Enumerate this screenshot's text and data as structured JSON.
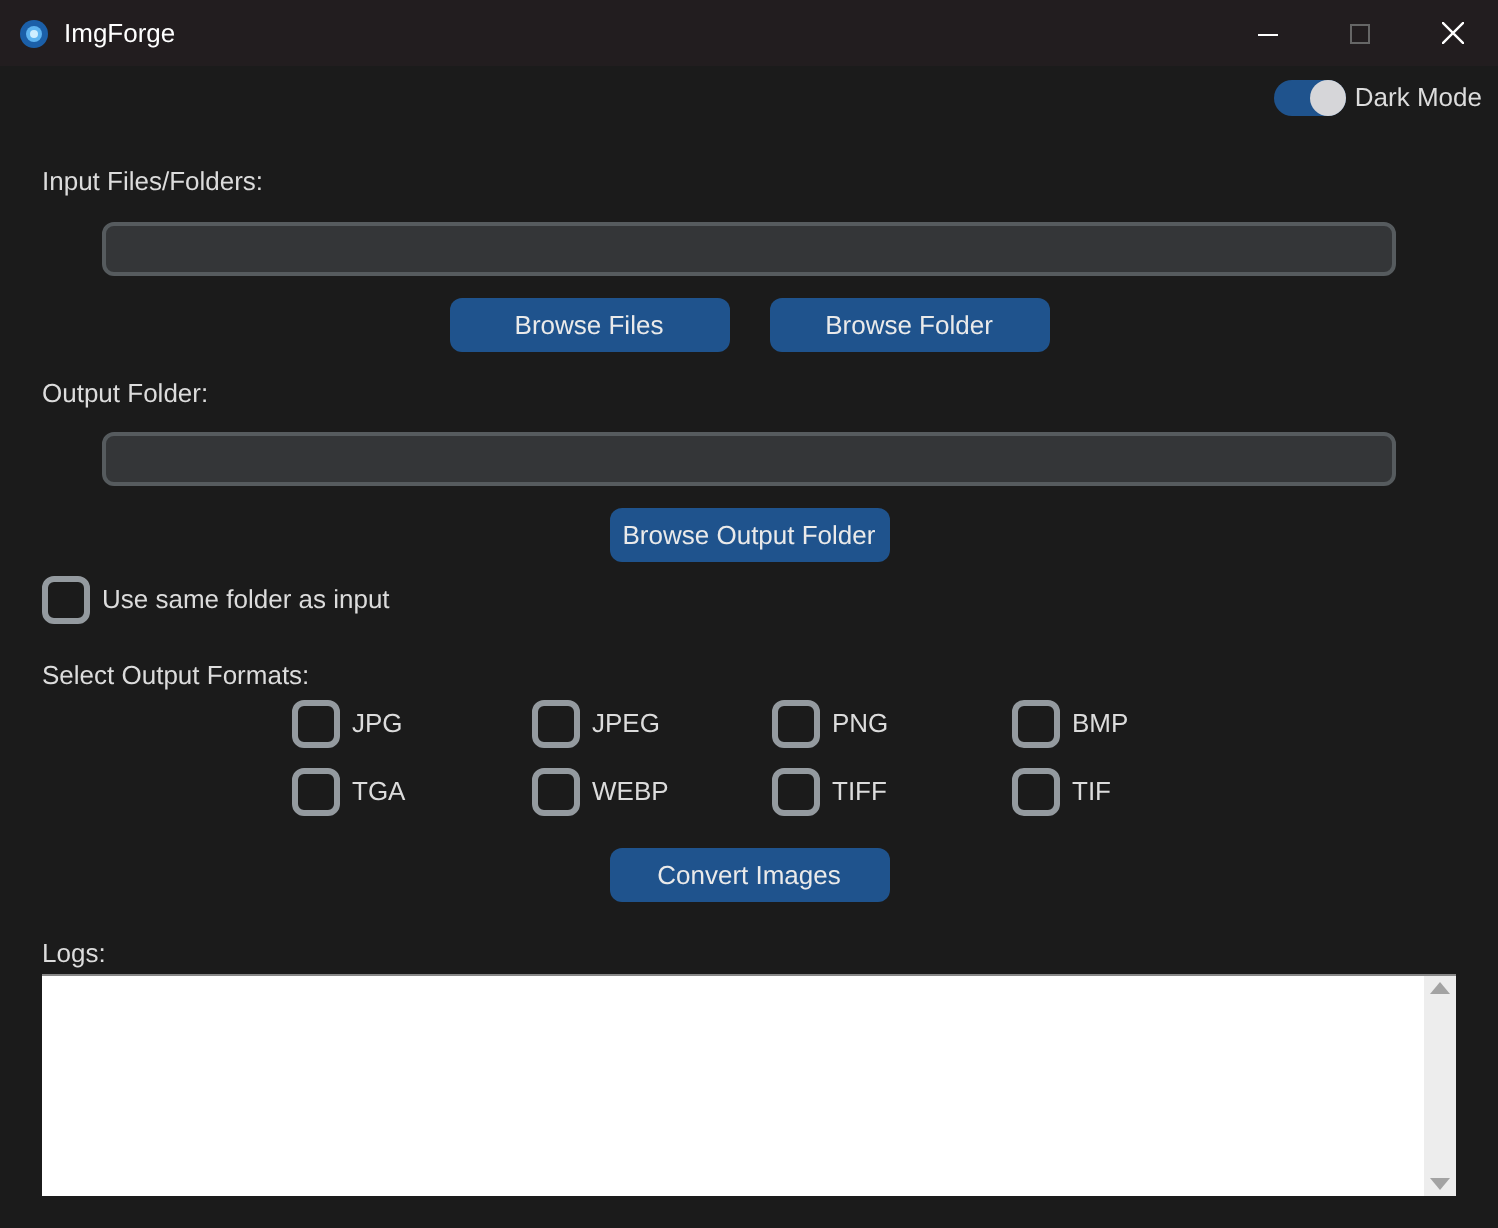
{
  "window": {
    "title": "ImgForge"
  },
  "dark_mode": {
    "label": "Dark Mode",
    "on": true
  },
  "input": {
    "label": "Input Files/Folders:"
  },
  "input_buttons": [
    "Browse Files",
    "Browse Folder"
  ],
  "output": {
    "label": "Output Folder:"
  },
  "output_button": "Browse Output Folder",
  "same_folder": {
    "label": "Use same folder as input",
    "checked": false
  },
  "formats_label": "Select Output Formats:",
  "formats": [
    {
      "label": "JPG",
      "checked": false
    },
    {
      "label": "JPEG",
      "checked": false
    },
    {
      "label": "PNG",
      "checked": false
    },
    {
      "label": "BMP",
      "checked": false
    },
    {
      "label": "TGA",
      "checked": false
    },
    {
      "label": "WEBP",
      "checked": false
    },
    {
      "label": "TIFF",
      "checked": false
    },
    {
      "label": "TIF",
      "checked": false
    }
  ],
  "convert_button": "Convert Images",
  "logs": {
    "label": "Logs:"
  }
}
